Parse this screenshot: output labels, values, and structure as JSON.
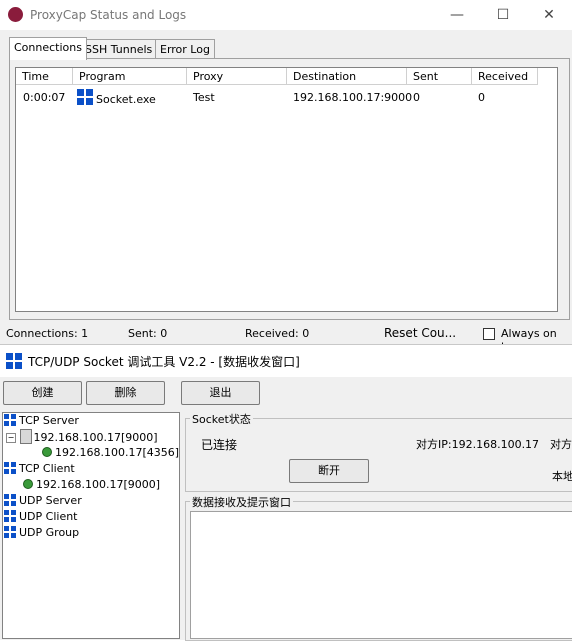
{
  "proxycap": {
    "title": "ProxyCap Status and Logs",
    "minimize": "—",
    "maximize": "☐",
    "close": "✕",
    "tabs": [
      "Connections",
      "SSH Tunnels",
      "Error Log"
    ],
    "columns": [
      "Time",
      "Program",
      "Proxy",
      "Destination",
      "Sent",
      "Received"
    ],
    "rows": [
      {
        "time": "0:00:07",
        "program": "Socket.exe",
        "proxy": "Test",
        "destination": "192.168.100.17:9000",
        "sent": "0",
        "received": "0"
      }
    ],
    "status": {
      "connections": "Connections: 1",
      "sent": "Sent:  0",
      "received": "Received:  0",
      "reset": "Reset Cou...",
      "always_on_top": "Always on top"
    }
  },
  "socket_tool": {
    "title": "TCP/UDP Socket 调试工具 V2.2 - [数据收发窗口]",
    "buttons": {
      "create": "创建",
      "delete": "删除",
      "exit": "退出"
    },
    "tree": {
      "tcp_server": "TCP Server",
      "server_addr": "192.168.100.17[9000]",
      "server_conn": "192.168.100.17[4356]",
      "tcp_client": "TCP Client",
      "client_addr": "192.168.100.17[9000]",
      "udp_server": "UDP Server",
      "udp_client": "UDP Client",
      "udp_group": "UDP Group"
    },
    "socket_status": {
      "legend": "Socket状态",
      "connected": "已连接",
      "peer_ip": "对方IP:192.168.100.17",
      "peer_port_partial": "对方",
      "local_partial": "本地",
      "disconnect": "断开"
    },
    "data_window": {
      "legend": "数据接收及提示窗口"
    }
  }
}
